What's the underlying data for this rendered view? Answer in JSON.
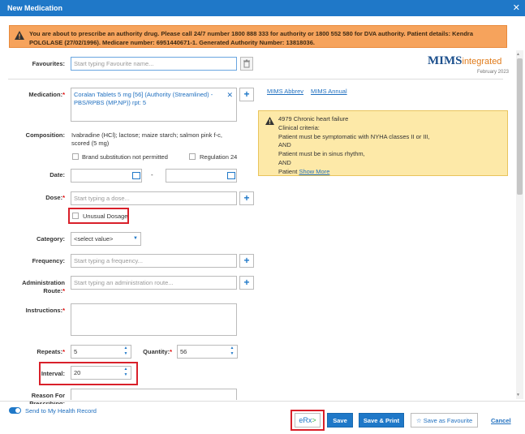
{
  "title": "New Medication",
  "warning": "You are about to prescribe an authority drug. Please call 24/7 number 1800 888 333 for authority or 1800 552 580 for DVA authority. Patient details: Kendra POLGLASE (27/02/1996). Medicare number: 6951440671-1. Generated Authority Number: 13818036.",
  "favourites": {
    "label": "Favourites:",
    "placeholder": "Start typing Favourite name..."
  },
  "mims": {
    "brand": "MIMS",
    "suffix": "integrated",
    "date": "February 2023",
    "abbrev": "MIMS Abbrev",
    "annual": "MIMS Annual"
  },
  "medication": {
    "label": "Medication:",
    "value": "Coralan Tablets 5 mg [56] (Authority (Streamlined) - PBS/RPBS (MP,NP)) rpt: 5"
  },
  "composition": {
    "label": "Composition:",
    "value": "Ivabradine (HCl); lactose; maize starch; salmon pink f-c, scored (5 mg)"
  },
  "brand_sub": "Brand substitution not permitted",
  "regulation": "Regulation 24",
  "date": {
    "label": "Date:",
    "sep": "-"
  },
  "dose": {
    "label": "Dose:",
    "placeholder": "Start typing a dose..."
  },
  "unusual": "Unusual Dosage",
  "category": {
    "label": "Category:",
    "value": "<select value>"
  },
  "frequency": {
    "label": "Frequency:",
    "placeholder": "Start typing a frequency..."
  },
  "route": {
    "label1": "Administration",
    "label2": "Route:",
    "placeholder": "Start typing an administration route..."
  },
  "instructions": {
    "label": "Instructions:"
  },
  "repeats": {
    "label": "Repeats:",
    "value": "5"
  },
  "quantity": {
    "label": "Quantity:",
    "value": "56"
  },
  "interval": {
    "label": "Interval:",
    "value": "20"
  },
  "reason": {
    "label1": "Reason For",
    "label2": "Prescribing:"
  },
  "info": {
    "line1": "4979 Chronic heart failure",
    "line2": "Clinical criteria:",
    "line3": "Patient must be symptomatic with NYHA classes II or III,",
    "line4": "AND",
    "line5": "Patient must be in sinus rhythm,",
    "line6": "AND",
    "line7": "Patient",
    "more": "Show More"
  },
  "footer": {
    "mhr": "Send to My Health Record",
    "erx": "eRx",
    "save": "Save",
    "save_print": "Save & Print",
    "fav": "Save as Favourite",
    "cancel": "Cancel"
  }
}
